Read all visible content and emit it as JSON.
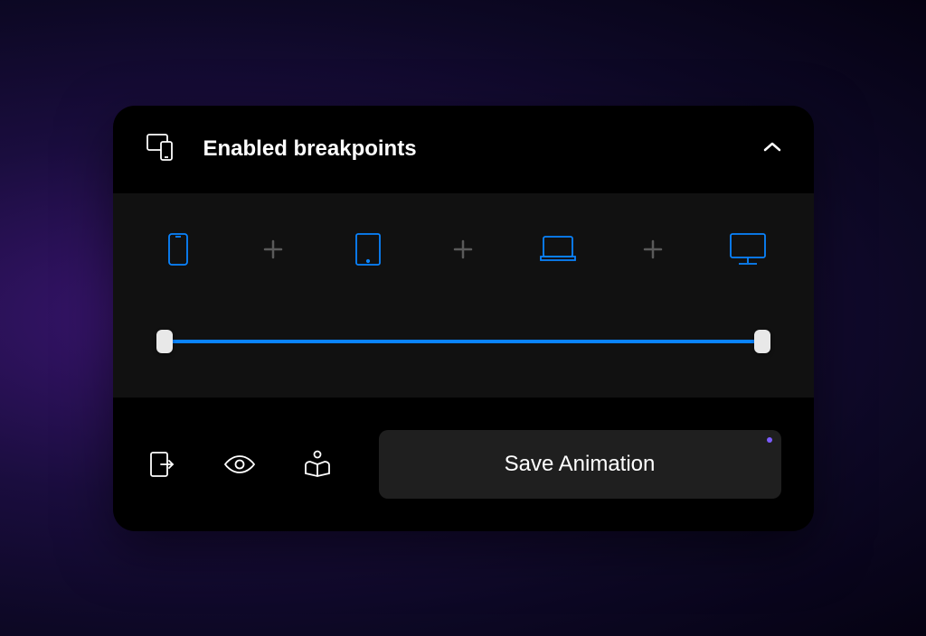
{
  "header": {
    "title": "Enabled breakpoints"
  },
  "breakpoints": {
    "items": [
      {
        "type": "phone"
      },
      {
        "type": "tablet"
      },
      {
        "type": "laptop"
      },
      {
        "type": "desktop"
      }
    ]
  },
  "footer": {
    "save_label": "Save Animation"
  },
  "colors": {
    "accent": "#0a84ff",
    "background": "#000000",
    "panel": "#111111",
    "button": "#1f1f1f",
    "indicator": "#7c5cff"
  }
}
